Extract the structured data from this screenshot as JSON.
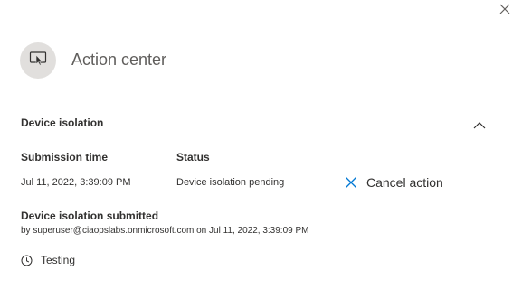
{
  "panel": {
    "title": "Action center",
    "icons": {
      "close": "close-icon",
      "header": "action-center-icon",
      "collapse": "chevron-up-icon",
      "cancel": "cancel-x-icon",
      "clock": "clock-icon"
    },
    "colors": {
      "icon_circle_bg": "#e1dfdd",
      "accent": "#0078d4",
      "divider": "#d6d6d6",
      "text": "#323130",
      "muted_text": "#605e5c"
    }
  },
  "section": {
    "title": "Device isolation",
    "headers": {
      "submission_time": "Submission time",
      "status": "Status"
    },
    "values": {
      "submission_time": "Jul 11, 2022, 3:39:09 PM",
      "status": "Device isolation pending"
    },
    "cancel_label": "Cancel action",
    "submitted_title": "Device isolation submitted",
    "submitted_by": "by superuser@ciaopslabs.onmicrosoft.com on Jul 11, 2022, 3:39:09 PM",
    "comment": "Testing"
  }
}
